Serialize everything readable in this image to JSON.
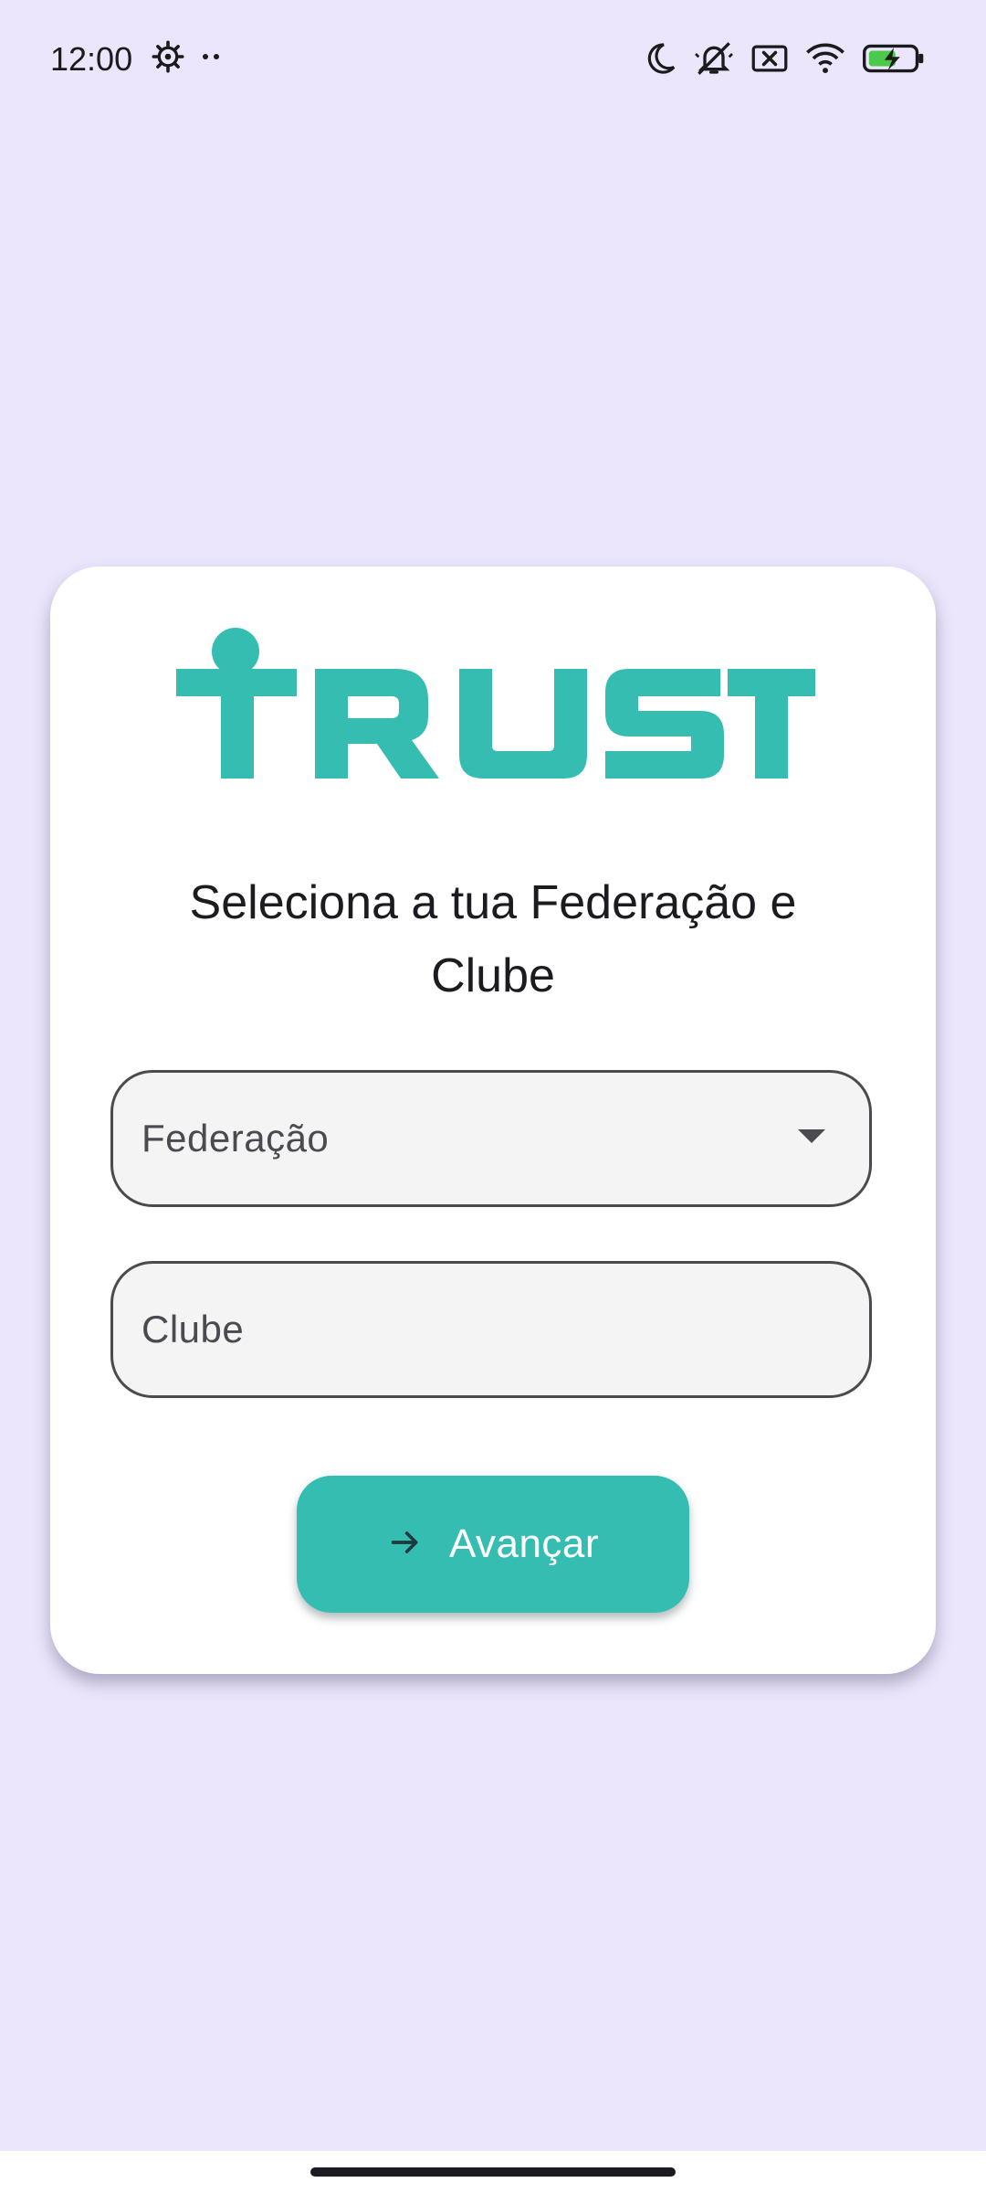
{
  "status_bar": {
    "time": "12:00",
    "icons": [
      "settings-gear-icon",
      "more-dots-icon",
      "do-not-disturb-moon-icon",
      "muted-bell-icon",
      "no-sim-icon",
      "wifi-icon",
      "battery-charging-icon"
    ]
  },
  "card": {
    "logo_text": "TRUST",
    "title": "Seleciona a tua Federação e Clube",
    "federacao_field": {
      "label": "Federação",
      "icon": "dropdown-arrow-icon"
    },
    "clube_field": {
      "label": "Clube"
    },
    "submit_button": {
      "label": "Avançar",
      "icon": "arrow-right-icon"
    }
  },
  "colors": {
    "background": "#ebe6fc",
    "brand_teal": "#35bdb2",
    "card": "#ffffff"
  }
}
